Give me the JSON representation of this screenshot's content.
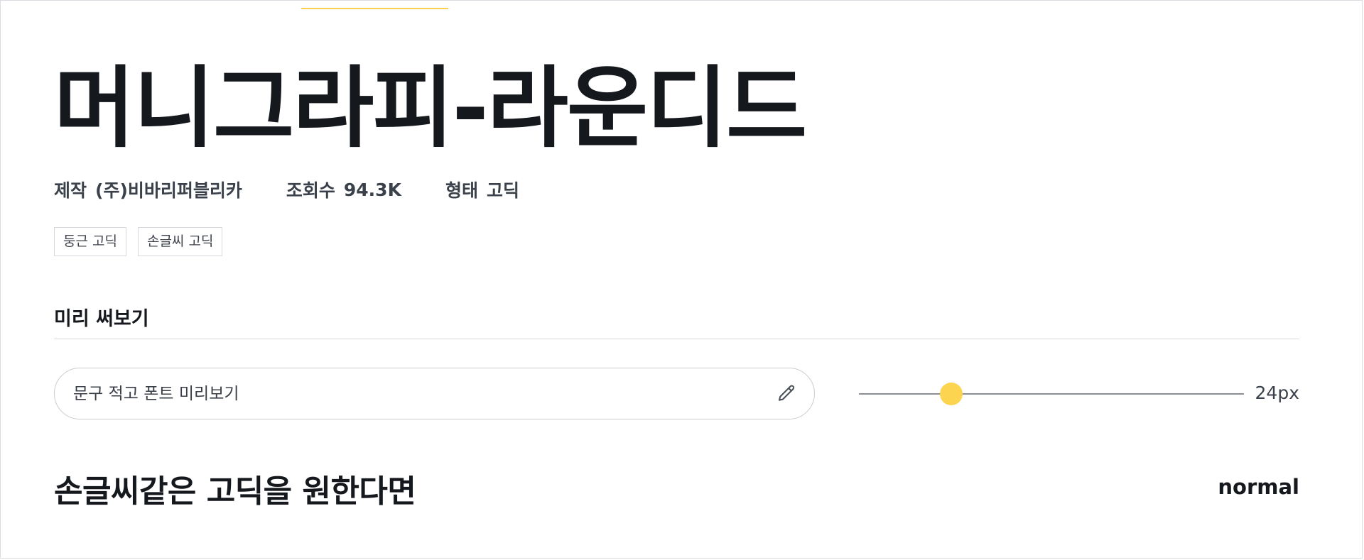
{
  "font": {
    "name": "머니그라피-라운디드",
    "meta": {
      "maker_label": "제작",
      "maker_value": "(주)비바리퍼블리카",
      "views_label": "조회수",
      "views_value": "94.3K",
      "type_label": "형태",
      "type_value": "고딕"
    },
    "tags": [
      "둥근 고딕",
      "손글씨 고딕"
    ]
  },
  "preview": {
    "section_title": "미리 써보기",
    "input_placeholder": "문구 적고 폰트 미리보기",
    "input_value": "",
    "edit_icon": "pencil-icon",
    "slider_level": 0.24,
    "size_value": "24px"
  },
  "sample": {
    "text": "손글씨같은 고딕을 원한다면",
    "weight": "normal"
  },
  "colors": {
    "accent": "#fdd44f",
    "text": "#15181d",
    "muted": "#3b414b",
    "border": "#d5d8dd"
  }
}
